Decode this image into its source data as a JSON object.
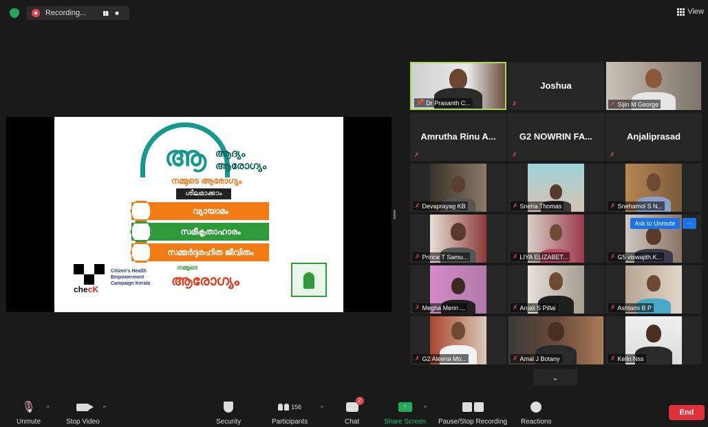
{
  "topbar": {
    "recording_label": "Recording...",
    "view_label": "View"
  },
  "slide": {
    "logo_line1": "ആദ്യം",
    "logo_line2": "ആരോഗ്യം",
    "logo_big": "ആ",
    "subtitle": "നമ്മുടെ ആരോഗ്യം",
    "tag": "ശീലമാക്കാം",
    "bars": [
      "വ്യായാമം",
      "സമീകൃതാഹാരം",
      "സമ്മർദ്ദരഹിത ജീവിതം"
    ],
    "check_word_1": "che",
    "check_word_2": "cK",
    "campaign_text": "Citizen's Health Empowerment Campaign Kerala",
    "nammude_small": "നമ്മുടെ",
    "nammude_big": "ആരോഗ്യം",
    "colors": {
      "teal": "#17988e",
      "orange": "#f27b16",
      "green": "#2e9a3a",
      "red": "#e23a1c"
    }
  },
  "participants": [
    {
      "name": "Dr Prasanth C...",
      "video": true,
      "pinned": true,
      "active": true
    },
    {
      "name": "Joshua",
      "video": false
    },
    {
      "name": "Sijin M George",
      "video": true
    },
    {
      "name": "Amrutha Rinu A...",
      "video": false
    },
    {
      "name": "G2 NOWRIN FA...",
      "video": false
    },
    {
      "name": "Anjaliprasad",
      "video": false
    },
    {
      "name": "Devaprayag KB",
      "video": true
    },
    {
      "name": "Sneha Thomas",
      "video": true
    },
    {
      "name": "Snehamol S N...",
      "video": true
    },
    {
      "name": "Prince T Samu...",
      "video": true
    },
    {
      "name": "LIYA ELIZABET...",
      "video": true
    },
    {
      "name": "G5 viswajith.K...",
      "video": true
    },
    {
      "name": "Megha Merin ...",
      "video": true
    },
    {
      "name": "Anjali S Pillai",
      "video": true
    },
    {
      "name": "Ashtami B P",
      "video": true
    },
    {
      "name": "G2 Aleena Mo...",
      "video": true
    },
    {
      "name": "Amal J Botany",
      "video": true
    },
    {
      "name": "Kelin Nss",
      "video": true
    }
  ],
  "ask_unmute": "Ask to Unmute",
  "more_label": "···",
  "toolbar": {
    "unmute": "Unmute",
    "stop_video": "Stop Video",
    "security": "Security",
    "participants": "Participants",
    "participants_count": "156",
    "chat": "Chat",
    "chat_badge": "2",
    "share_screen": "Share Screen",
    "pause_recording": "Pause/Stop Recording",
    "reactions": "Reactions",
    "end": "End"
  }
}
